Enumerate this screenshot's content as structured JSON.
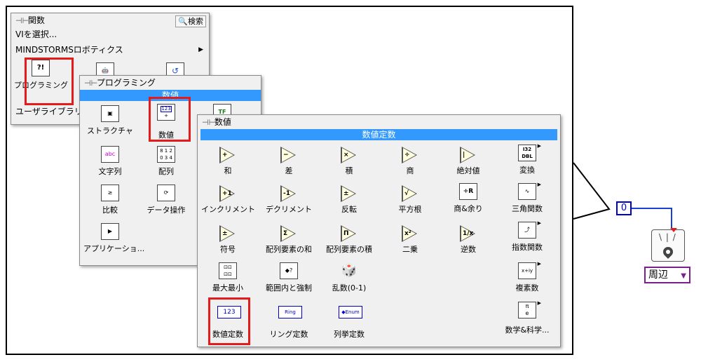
{
  "functions_palette": {
    "title": "関数",
    "search_label": "検索",
    "menu_items": [
      "VIを選択...",
      "MINDSTORMSロボティクス"
    ],
    "tiles": [
      "プログラミング",
      "ユーザライブラリ"
    ]
  },
  "programming_palette": {
    "title": "プログラミング",
    "header": "数値",
    "tiles": [
      "ストラクチャ",
      "数値",
      "文字列",
      "配列",
      "比較",
      "データ操作",
      "アプリケーショ..."
    ]
  },
  "numeric_palette": {
    "title": "数値",
    "header": "数値定数",
    "tiles": [
      "和",
      "差",
      "積",
      "商",
      "絶対値",
      "変換",
      "インクリメント",
      "デクリメント",
      "反転",
      "平方根",
      "商&余り",
      "三角関数",
      "符号",
      "配列要素の和",
      "配列要素の積",
      "二乗",
      "逆数",
      "指数関数",
      "最大最小",
      "範囲内と強制",
      "乱数(0-1)",
      "複素数",
      "数値定数",
      "リング定数",
      "列挙定数",
      "数学&科学..."
    ]
  },
  "icon_text": {
    "numeric_const": "123",
    "ring": "Ring",
    "enum": "◆Enum",
    "i32": "I32",
    "dbl": "DBL",
    "string": "abc",
    "complex": "x+iy",
    "pi": "π",
    "tf": "TF"
  },
  "block": {
    "constant_value": "0",
    "mode_label": "周辺"
  },
  "colors": {
    "selection": "#e31b1b",
    "header_bar": "#3399ff",
    "constant_blue": "#0000cc",
    "dropdown_border": "#7a1f8c"
  }
}
